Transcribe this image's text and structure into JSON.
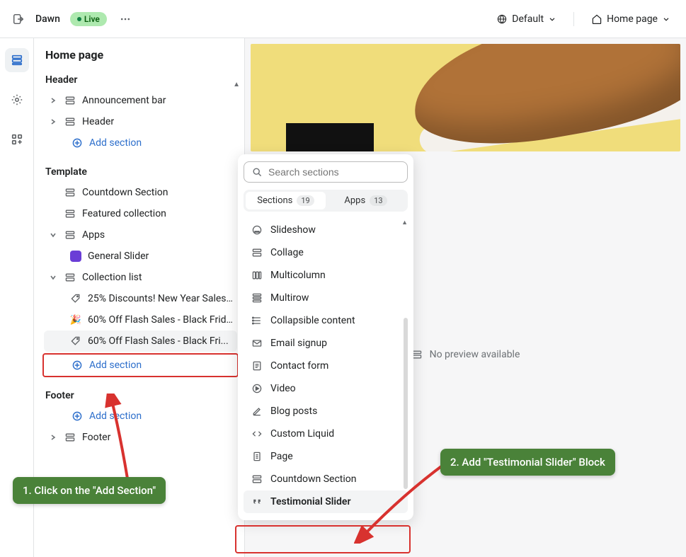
{
  "topbar": {
    "theme_name": "Dawn",
    "live_badge": "Live",
    "locale_label": "Default",
    "page_label": "Home page"
  },
  "sidebar": {
    "title": "Home page",
    "header_label": "Header",
    "header_items": [
      {
        "label": "Announcement bar"
      },
      {
        "label": "Header"
      }
    ],
    "header_add": "Add section",
    "template_label": "Template",
    "template_items": [
      {
        "label": "Countdown Section",
        "chev": false,
        "icon": "section"
      },
      {
        "label": "Featured collection",
        "chev": false,
        "icon": "section"
      },
      {
        "label": "Apps",
        "chev": true,
        "open": true,
        "icon": "section"
      },
      {
        "label": "General Slider",
        "indent": 2,
        "icon": "app-purple"
      },
      {
        "label": "Collection list",
        "chev": true,
        "open": true,
        "icon": "section"
      },
      {
        "label": "25% Discounts! New Year Sales...",
        "indent": 2,
        "icon": "tag"
      },
      {
        "label": "60% Off Flash Sales - Black Frid...",
        "indent": 2,
        "icon": "sparkle"
      },
      {
        "label": "60% Off Flash Sales - Black Fri...",
        "indent": 2,
        "icon": "tag",
        "hover": true
      }
    ],
    "template_add": "Add section",
    "footer_label": "Footer",
    "footer_add": "Add section",
    "footer_items": [
      {
        "label": "Footer"
      }
    ]
  },
  "popover": {
    "search_placeholder": "Search sections",
    "tab_sections": "Sections",
    "tab_sections_count": "19",
    "tab_apps": "Apps",
    "tab_apps_count": "13",
    "items": [
      {
        "label": "Slideshow",
        "icon": "slideshow"
      },
      {
        "label": "Collage",
        "icon": "section"
      },
      {
        "label": "Multicolumn",
        "icon": "columns"
      },
      {
        "label": "Multirow",
        "icon": "rows"
      },
      {
        "label": "Collapsible content",
        "icon": "list"
      },
      {
        "label": "Email signup",
        "icon": "mail"
      },
      {
        "label": "Contact form",
        "icon": "form"
      },
      {
        "label": "Video",
        "icon": "play"
      },
      {
        "label": "Blog posts",
        "icon": "edit"
      },
      {
        "label": "Custom Liquid",
        "icon": "code"
      },
      {
        "label": "Page",
        "icon": "page"
      },
      {
        "label": "Countdown Section",
        "icon": "section"
      },
      {
        "label": "Testimonial Slider",
        "icon": "quote",
        "selected": true
      }
    ]
  },
  "preview": {
    "no_preview": "No preview available"
  },
  "callouts": {
    "step1": "1. Click on the \"Add Section\"",
    "step2": "2. Add \"Testimonial Slider\" Block"
  }
}
